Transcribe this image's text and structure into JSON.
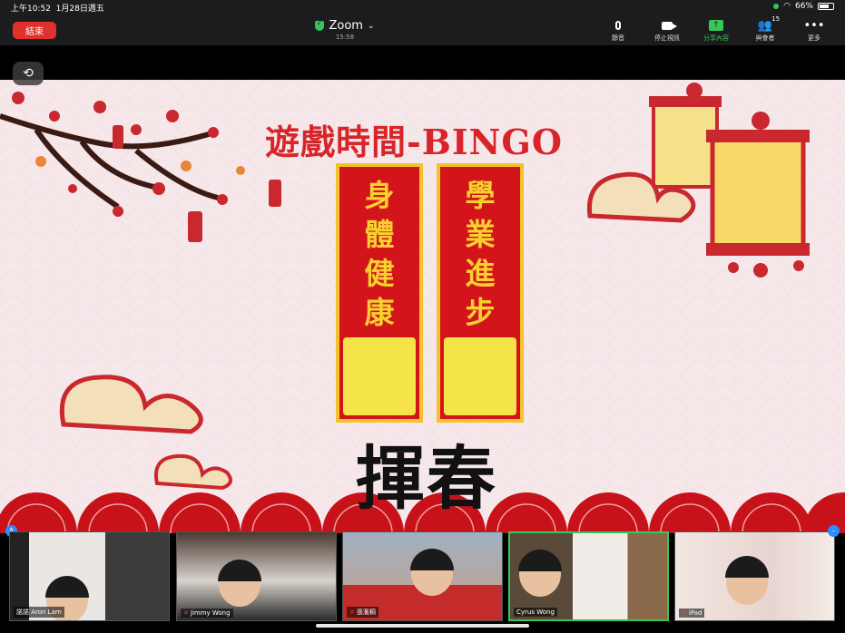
{
  "status_bar": {
    "time": "上午10:52",
    "date": "1月28日週五",
    "battery": "66%"
  },
  "toolbar": {
    "end_label": "結束",
    "app_title": "Zoom",
    "elapsed": "15:58",
    "tools": [
      {
        "label": "靜音",
        "icon": "microphone-icon"
      },
      {
        "label": "停止視訊",
        "icon": "video-camera-icon"
      },
      {
        "label": "分享內容",
        "icon": "share-screen-icon"
      },
      {
        "label": "與會者",
        "icon": "participants-icon",
        "count": "15"
      },
      {
        "label": "更多",
        "icon": "more-dots-icon"
      }
    ],
    "accent": "#35c759",
    "end_color": "#e0312c"
  },
  "slide": {
    "title": "遊戲時間-BINGO",
    "couplet_left": [
      "身",
      "體",
      "健",
      "康"
    ],
    "couplet_right": [
      "學",
      "業",
      "進",
      "步"
    ],
    "caption": "揮春",
    "title_color": "#d8252a"
  },
  "participants": [
    {
      "name": "諾諾 Aron Lam",
      "muted": false
    },
    {
      "name": "Jimmy Wong",
      "muted": true
    },
    {
      "name": "張滙桐",
      "muted": true
    },
    {
      "name": "Cyrus Wong",
      "muted": false
    },
    {
      "name": "iPad",
      "muted": true
    }
  ]
}
